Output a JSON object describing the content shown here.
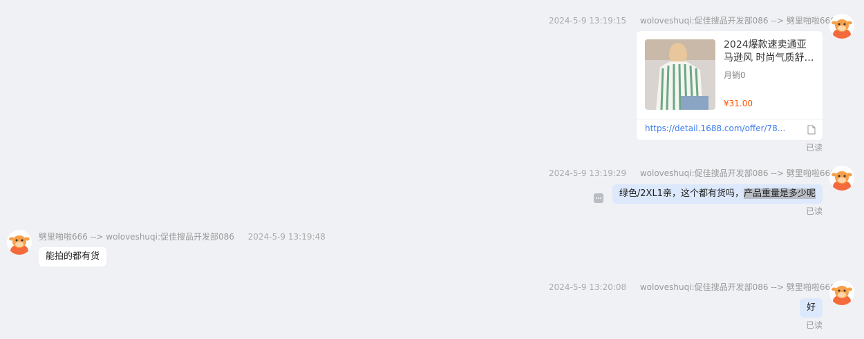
{
  "messages": [
    {
      "time": "2024-5-9 13:19:15",
      "route": "woloveshuqi:促佳搜品开发部086 --> 劈里啪啦666",
      "card": {
        "title_line1": "2024爆款速卖通亚",
        "title_line2": "马逊风 时尚气质舒…",
        "sales": "月销0",
        "price": "¥31.00",
        "link": "https://detail.1688.com/offer/78..."
      },
      "status": "已读"
    },
    {
      "time": "2024-5-9 13:19:29",
      "route": "woloveshuqi:促佳搜品开发部086 --> 劈里啪啦666",
      "text_plain": "绿色/2XL1亲，这个都有货吗，",
      "text_highlight": "产品重量是多少呢",
      "status": "已读"
    },
    {
      "time": "2024-5-9 13:19:48",
      "route": "劈里啪啦666 --> woloveshuqi:促佳搜品开发部086",
      "text": "能拍的都有货"
    },
    {
      "time": "2024-5-9 13:20:08",
      "route": "woloveshuqi:促佳搜品开发部086 --> 劈里啪啦666",
      "text": "好",
      "status": "已读"
    }
  ],
  "icons": {
    "avatar": "cow-avatar-icon",
    "more": "more-icon",
    "doc": "document-icon"
  },
  "colors": {
    "background": "#f0f1f5",
    "out_bubble": "#dce8fb",
    "price": "#ff5000",
    "link": "#3b7ded"
  }
}
